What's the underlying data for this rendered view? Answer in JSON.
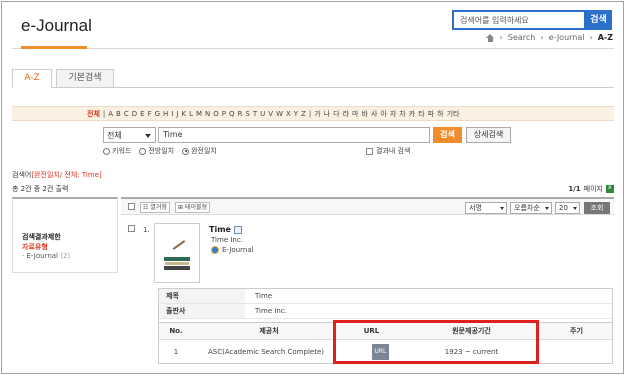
{
  "header": {
    "app_title": "e-Journal",
    "search_placeholder": "검색어를 입력하세요",
    "search_button": "검색",
    "breadcrumb": [
      "Search",
      "e-Journal",
      "A-Z"
    ]
  },
  "tabs": [
    {
      "label": "A-Z",
      "active": true
    },
    {
      "label": "기본검색",
      "active": false
    }
  ],
  "alphabet": [
    "전체",
    "|",
    "A",
    "B",
    "C",
    "D",
    "E",
    "F",
    "G",
    "H",
    "I",
    "J",
    "K",
    "L",
    "M",
    "N",
    "O",
    "P",
    "Q",
    "R",
    "S",
    "T",
    "U",
    "V",
    "W",
    "X",
    "Y",
    "Z",
    "|",
    "가",
    "나",
    "다",
    "라",
    "마",
    "바",
    "사",
    "아",
    "자",
    "차",
    "카",
    "타",
    "파",
    "하",
    "기타"
  ],
  "search": {
    "field_selected": "전체",
    "query": "Time",
    "search_button": "검색",
    "advanced_button": "상세검색",
    "match_options": [
      {
        "label": "키워드",
        "checked": false
      },
      {
        "label": "전방일치",
        "checked": false
      },
      {
        "label": "완전일치",
        "checked": true
      }
    ],
    "within_results": "결과내 검색"
  },
  "summary": {
    "prefix": "검색어",
    "highlight": "[완전일치/ 전체: Time]",
    "total": "총 2건 중 2건 출력",
    "page_info": "1/1",
    "page_suffix": "페이지"
  },
  "facet": {
    "heading": "검색결과제한",
    "subheading": "자료유형",
    "items": [
      {
        "label": "· E-Journal",
        "count": "(2)"
      }
    ]
  },
  "toolbar": {
    "list_view": "☷ 열거형",
    "table_view": "⊞ 테이블형",
    "sort_field": "서명",
    "sort_order": "오름차순",
    "page_size": "20",
    "go_button": "조회"
  },
  "result": {
    "index": "1.",
    "title": "Time",
    "publisher": "Time Inc.",
    "source": "E-Journal",
    "details": [
      {
        "label": "제목",
        "value": "Time"
      },
      {
        "label": "출판사",
        "value": "Time Inc."
      }
    ],
    "table_headers": [
      "No.",
      "제공처",
      "URL",
      "원문제공기간",
      "주기"
    ],
    "table_rows": [
      {
        "no": "1",
        "provider": "ASC(Academic Search Complete)",
        "url": "URL",
        "period": "1923 ~ current",
        "note": ""
      }
    ]
  },
  "colors": {
    "accent_orange": "#f08c2c",
    "header_blue": "#2a6fc9",
    "highlight_red": "#e01f1f"
  }
}
